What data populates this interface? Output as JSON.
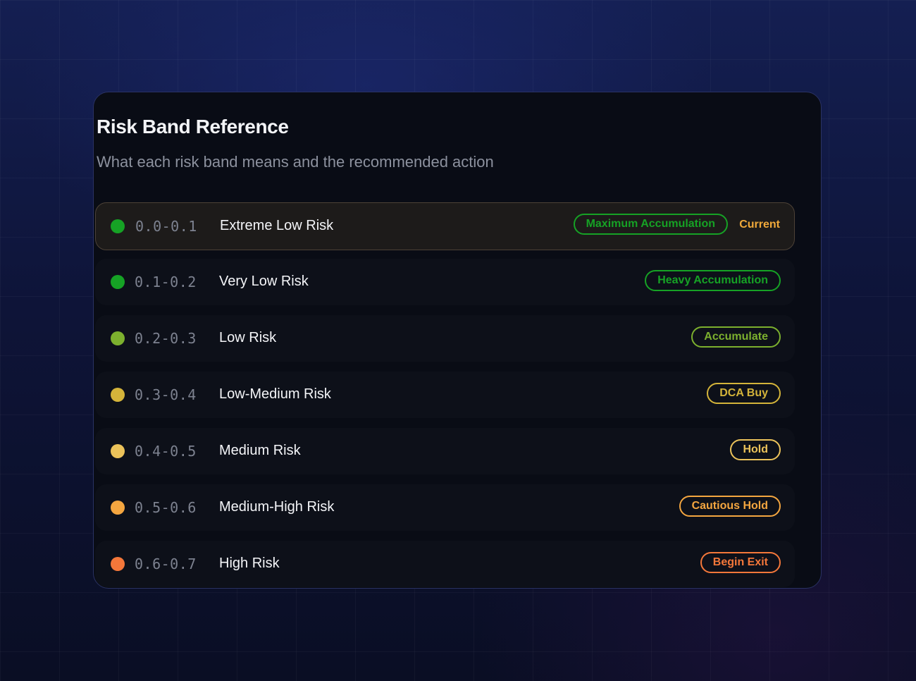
{
  "header": {
    "title": "Risk Band Reference",
    "subtitle": "What each risk band means and the recommended action"
  },
  "current_label": "Current",
  "bands": [
    {
      "range": "0.0-0.1",
      "name": "Extreme Low Risk",
      "action": "Maximum Accumulation",
      "color": "#16a225",
      "current": true
    },
    {
      "range": "0.1-0.2",
      "name": "Very Low Risk",
      "action": "Heavy Accumulation",
      "color": "#16a225",
      "current": false
    },
    {
      "range": "0.2-0.3",
      "name": "Low Risk",
      "action": "Accumulate",
      "color": "#7cb02e",
      "current": false
    },
    {
      "range": "0.3-0.4",
      "name": "Low-Medium Risk",
      "action": "DCA Buy",
      "color": "#d4b43a",
      "current": false
    },
    {
      "range": "0.4-0.5",
      "name": "Medium Risk",
      "action": "Hold",
      "color": "#ebc25a",
      "current": false
    },
    {
      "range": "0.5-0.6",
      "name": "Medium-High Risk",
      "action": "Cautious Hold",
      "color": "#f4a640",
      "current": false
    },
    {
      "range": "0.6-0.7",
      "name": "High Risk",
      "action": "Begin Exit",
      "color": "#f4773a",
      "current": false
    }
  ]
}
